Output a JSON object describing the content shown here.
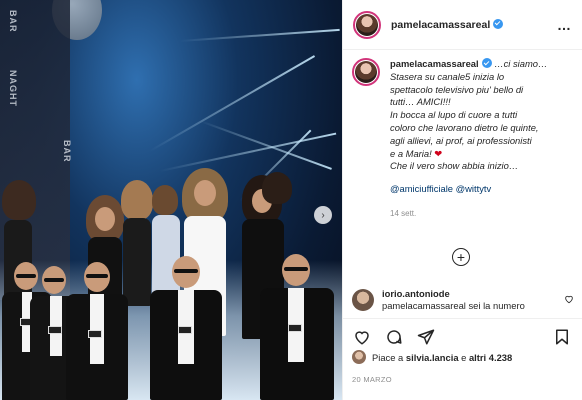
{
  "post": {
    "username": "pamelacamassareal",
    "more_icon": "…"
  },
  "caption": {
    "username": "pamelacamassareal",
    "line1": "…ci siamo…",
    "line2": "Stasera su canale5 inizia lo",
    "line3": "spettacolo televisivo piu' bello di",
    "line4": "tutti… AMICI!!!",
    "line5": "In bocca al lupo di cuore a tutti",
    "line6": "coloro che lavorano dietro le quinte,",
    "line7": "agli allievi, ai prof, ai professionisti",
    "line8": "e a Maria!",
    "heart": "❤",
    "line9": "Che il vero show abbia inizio…",
    "tag1": "@amiciufficiale",
    "tag2": "@wittytv",
    "time": "14 sett."
  },
  "comment": {
    "username": "iorio.antoniode",
    "text": "pamelacamassareal sei la numero"
  },
  "likes": {
    "prefix": "Piace a",
    "user": "silvia.lancia",
    "middle": "e",
    "others": "altri 4.238"
  },
  "date": "20 MARZO",
  "icons": {
    "add": "+",
    "next": "›"
  }
}
